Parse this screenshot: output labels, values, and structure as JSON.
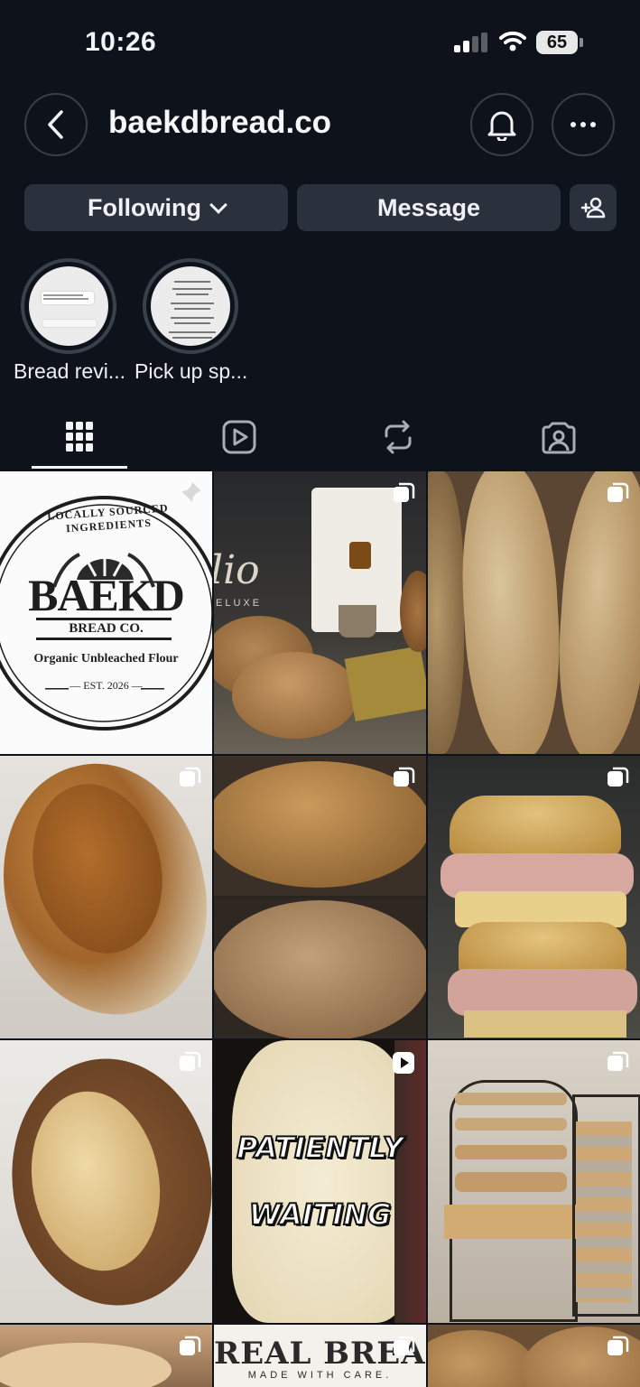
{
  "status_bar": {
    "time": "10:26",
    "battery": "65"
  },
  "header": {
    "username": "baekdbread.co"
  },
  "actions": {
    "following_label": "Following",
    "message_label": "Message"
  },
  "highlights": [
    {
      "label": "Bread revi..."
    },
    {
      "label": "Pick up sp..."
    }
  ],
  "tabs": [
    "grid-tab",
    "reels-tab",
    "reposts-tab",
    "tagged-tab"
  ],
  "posts": {
    "logo": {
      "arc": "LOCALLY SOURCED INGREDIENTS",
      "brand": "BAEKD",
      "sub": "BREAD CO.",
      "tagline": "Organic Unbleached Flour",
      "est": "— EST. 2026 —"
    },
    "olio": {
      "brand": "lio",
      "sub": "ELUXE"
    },
    "video_caption": {
      "line1": "PATIENTLY",
      "line2": "WAITING"
    },
    "real_bread": {
      "title": "REAL BREAD",
      "sub": "MADE WITH CARE."
    }
  },
  "colors": {
    "background": "#0d121b",
    "button": "#2a313d",
    "text": "#f2f4f7"
  }
}
